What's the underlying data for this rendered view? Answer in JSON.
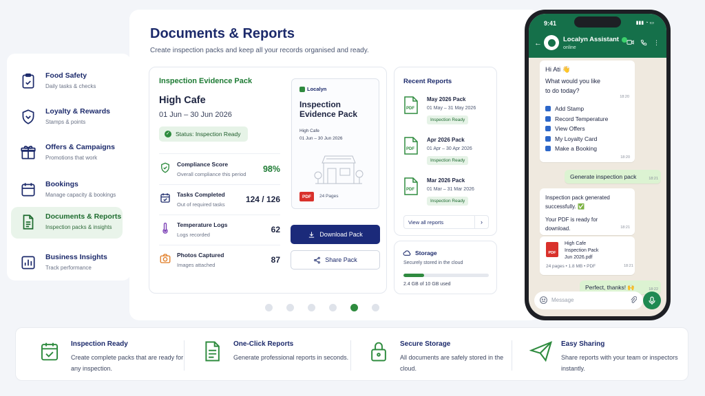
{
  "sidebar": {
    "items": [
      {
        "title": "Food Safety",
        "subtitle": "Daily tasks & checks",
        "icon": "clipboard-icon"
      },
      {
        "title": "Loyalty & Rewards",
        "subtitle": "Stamps & points",
        "icon": "shield-heart-icon"
      },
      {
        "title": "Offers & Campaigns",
        "subtitle": "Promotions that work",
        "icon": "gift-icon"
      },
      {
        "title": "Bookings",
        "subtitle": "Manage capacity & bookings",
        "icon": "calendar-icon"
      },
      {
        "title": "Documents & Reports",
        "subtitle": "Inspection packs & insights",
        "icon": "document-icon"
      },
      {
        "title": "Business Insights",
        "subtitle": "Track performance",
        "icon": "bar-chart-icon"
      }
    ]
  },
  "main": {
    "title": "Documents & Reports",
    "subtitle": "Create inspection packs and keep all your records organised and ready."
  },
  "evidence": {
    "heading": "Inspection Evidence Pack",
    "cafe": "High Cafe",
    "dates": "01 Jun – 30 Jun 2026",
    "status": "Status: Inspection Ready",
    "metrics": [
      {
        "title": "Compliance Score",
        "subtitle": "Overall compliance this period",
        "value": "98%"
      },
      {
        "title": "Tasks Completed",
        "subtitle": "Out of required tasks",
        "value": "124 / 126"
      },
      {
        "title": "Temperature Logs",
        "subtitle": "Logs recorded",
        "value": "62"
      },
      {
        "title": "Photos Captured",
        "subtitle": "Images attached",
        "value": "87"
      }
    ],
    "preview": {
      "brand": "Localyn",
      "title": "Inspection Evidence Pack",
      "cafe": "High Cafe",
      "dates": "01 Jun – 30 Jun 2026",
      "pdf_tag": "PDF",
      "pages": "24 Pages"
    },
    "download_label": "Download Pack",
    "share_label": "Share Pack"
  },
  "recent": {
    "title": "Recent Reports",
    "reports": [
      {
        "name": "May 2026 Pack",
        "dates": "01 May – 31 May 2026",
        "badge": "Inspection Ready"
      },
      {
        "name": "Apr 2026 Pack",
        "dates": "01 Apr – 30 Apr 2026",
        "badge": "Inspection Ready"
      },
      {
        "name": "Mar 2026 Pack",
        "dates": "01 Mar – 31 Mar 2026",
        "badge": "Inspection Ready"
      }
    ],
    "view_all": "View all reports"
  },
  "storage": {
    "title": "Storage",
    "subtitle": "Securely stored in the cloud",
    "used_text": "2.4 GB of 10 GB used",
    "used_fraction": 0.24,
    "accent": "#2f8a3f"
  },
  "carousel": {
    "count": 6,
    "active": 4
  },
  "features": [
    {
      "title": "Inspection Ready",
      "text": "Create complete packs that are ready for any inspection.",
      "icon": "calendar-check-icon"
    },
    {
      "title": "One-Click Reports",
      "text": "Generate professional reports in seconds.",
      "icon": "document-icon"
    },
    {
      "title": "Secure Storage",
      "text": "All documents are safely stored in the cloud.",
      "icon": "lock-icon"
    },
    {
      "title": "Easy Sharing",
      "text": "Share reports with your team or inspectors instantly.",
      "icon": "paper-plane-icon"
    }
  ],
  "phone": {
    "time": "9:41",
    "contact": "Localyn Assistant",
    "presence": "online",
    "greeting_line1": "Hi Ati 👋",
    "greeting_line2": "What would you like",
    "greeting_line3": "to do today?",
    "greeting_time": "18:20",
    "menu": [
      "Add Stamp",
      "Record Temperature",
      "View Offers",
      "My Loyalty Card",
      "Make a Booking"
    ],
    "menu_time": "18:20",
    "user_msg": "Generate inspection pack",
    "user_time": "18:21",
    "reply_line1": "Inspection pack generated",
    "reply_line2": "successfully. ✅",
    "reply_line3": "Your PDF is ready for",
    "reply_line4": "download.",
    "reply_time": "18:21",
    "file_name_1": "High Cafe",
    "file_name_2": "Inspection Pack",
    "file_name_3": "Jun 2026.pdf",
    "file_pdf_tag": "PDF",
    "file_meta": "24 pages • 1.8 MB • PDF",
    "file_time": "18:21",
    "thanks_msg": "Perfect, thanks! 🙌",
    "thanks_time": "18:22",
    "input_placeholder": "Message"
  }
}
